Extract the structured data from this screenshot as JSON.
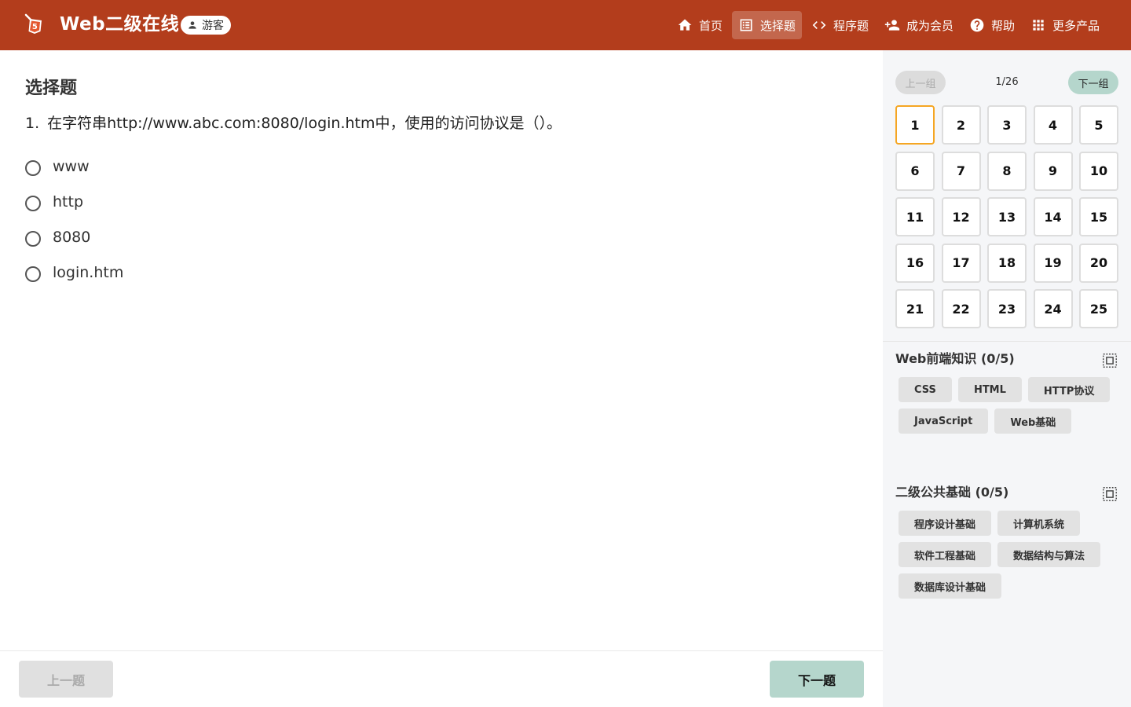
{
  "header": {
    "title": "Web二级在线",
    "guest_label": "游客",
    "nav": [
      {
        "label": "首页",
        "icon": "home-icon"
      },
      {
        "label": "选择题",
        "icon": "list-icon",
        "active": true
      },
      {
        "label": "程序题",
        "icon": "code-icon"
      },
      {
        "label": "成为会员",
        "icon": "add-person-icon"
      },
      {
        "label": "帮助",
        "icon": "help-icon"
      },
      {
        "label": "更多产品",
        "icon": "grid-icon"
      }
    ],
    "accent_color": "#b33d1c"
  },
  "main": {
    "section_title": "选择题",
    "question": {
      "number": "1.",
      "text": "在字符串http://www.abc.com:8080/login.htm中，使用的访问协议是（）。",
      "options": [
        "www",
        "http",
        "8080",
        "login.htm"
      ]
    },
    "prev_label": "上一题",
    "next_label": "下一题"
  },
  "sidebar": {
    "group_prev_label": "上一组",
    "group_next_label": "下一组",
    "group_count": "1/26",
    "questions": [
      "1",
      "2",
      "3",
      "4",
      "5",
      "6",
      "7",
      "8",
      "9",
      "10",
      "11",
      "12",
      "13",
      "14",
      "15",
      "16",
      "17",
      "18",
      "19",
      "20",
      "21",
      "22",
      "23",
      "24",
      "25"
    ],
    "current_question": "1",
    "categories": [
      {
        "title": "Web前端知识 (0/5)",
        "tags": [
          "CSS",
          "HTML",
          "HTTP协议",
          "JavaScript",
          "Web基础"
        ]
      },
      {
        "title": "二级公共基础 (0/5)",
        "tags": [
          "程序设计基础",
          "计算机系统",
          "软件工程基础",
          "数据结构与算法",
          "数据库设计基础"
        ]
      }
    ]
  }
}
